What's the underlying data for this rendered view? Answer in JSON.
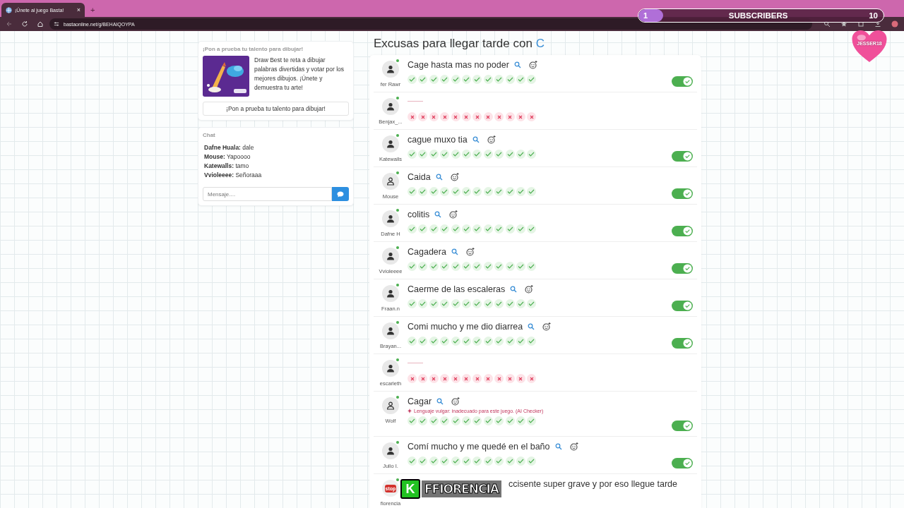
{
  "browser": {
    "tab_title": "¡Únete al juego Basta!",
    "tab_close": "×",
    "new_tab": "+",
    "url": "bastaonline.net/g/BEHAIQOYPA"
  },
  "promo": {
    "heading": "¡Pon a prueba tu talento para dibujar!",
    "text": "Draw Best te reta a dibujar palabras divertidas y votar por los mejores dibujos. ¡Únete y demuestra tu arte!",
    "button": "¡Pon a prueba tu talento para dibujar!"
  },
  "chat": {
    "heading": "Chat",
    "messages": [
      {
        "user": "Dafne Huala:",
        "text": "dale"
      },
      {
        "user": "Mouse:",
        "text": "Yapoooo"
      },
      {
        "user": "Katewalls:",
        "text": "tamo"
      },
      {
        "user": "Vvioleeee:",
        "text": "Señoraaa"
      }
    ],
    "placeholder": "Mensaje...."
  },
  "category": {
    "title": "Excusas para llegar tarde con",
    "letter": "C"
  },
  "rows": [
    {
      "user": "fer Rawr",
      "avatar": {
        "kind": "person"
      },
      "kind": "word",
      "answer": "Cage hasta mas no poder",
      "votes": [
        true,
        true,
        true,
        true,
        true,
        true,
        true,
        true,
        true,
        true,
        true,
        true
      ],
      "on": true
    },
    {
      "user": "Benjax_...",
      "avatar": {
        "kind": "person"
      },
      "kind": "empty",
      "votes": [
        false,
        false,
        false,
        false,
        false,
        false,
        false,
        false,
        false,
        false,
        false,
        false
      ]
    },
    {
      "user": "Katewalls",
      "avatar": {
        "kind": "person"
      },
      "kind": "word",
      "answer": "cague muxo tia",
      "votes": [
        true,
        true,
        true,
        true,
        true,
        true,
        true,
        true,
        true,
        true,
        true,
        true
      ],
      "on": true
    },
    {
      "user": "Mouse",
      "avatar": {
        "kind": "outline"
      },
      "kind": "word",
      "answer": "Caida",
      "votes": [
        true,
        true,
        true,
        true,
        true,
        true,
        true,
        true,
        true,
        true,
        true,
        true
      ],
      "on": true
    },
    {
      "user": "Dafne H",
      "avatar": {
        "kind": "person"
      },
      "kind": "word",
      "answer": "colitis",
      "votes": [
        true,
        true,
        true,
        true,
        true,
        true,
        true,
        true,
        true,
        true,
        true,
        true
      ],
      "on": true
    },
    {
      "user": "Vvioleeee",
      "avatar": {
        "kind": "person"
      },
      "kind": "word",
      "answer": "Cagadera",
      "votes": [
        true,
        true,
        true,
        true,
        true,
        true,
        true,
        true,
        true,
        true,
        true,
        true
      ],
      "on": true
    },
    {
      "user": "Fraan.n",
      "avatar": {
        "kind": "person"
      },
      "kind": "word",
      "answer": "Caerme de las escaleras",
      "votes": [
        true,
        true,
        true,
        true,
        true,
        true,
        true,
        true,
        true,
        true,
        true,
        true
      ],
      "on": true
    },
    {
      "user": "Brayan...",
      "avatar": {
        "kind": "person"
      },
      "kind": "word",
      "answer": "Comi mucho y me dio diarrea",
      "votes": [
        true,
        true,
        true,
        true,
        true,
        true,
        true,
        true,
        true,
        true,
        true,
        true
      ],
      "on": true
    },
    {
      "user": "escarleth",
      "avatar": {
        "kind": "person"
      },
      "kind": "empty",
      "votes": [
        false,
        false,
        false,
        false,
        false,
        false,
        false,
        false,
        false,
        false,
        false,
        false
      ]
    },
    {
      "user": "Wolf",
      "avatar": {
        "kind": "outline"
      },
      "kind": "word",
      "answer": "Cagar",
      "warning": "Lenguaje vulgar: inadecuado para este juego.",
      "warning_source": "(AI Checker)",
      "votes": [
        true,
        true,
        true,
        true,
        true,
        true,
        true,
        true,
        true,
        true,
        true,
        true
      ],
      "on": true
    },
    {
      "user": "Julio I.",
      "avatar": {
        "kind": "person"
      },
      "kind": "word",
      "answer": "Comí mucho y me quedé en el baño",
      "votes": [
        true,
        true,
        true,
        true,
        true,
        true,
        true,
        true,
        true,
        true,
        true,
        true
      ],
      "on": true
    },
    {
      "user": "fiorencia",
      "avatar": {
        "kind": "stop",
        "text": "stop"
      },
      "kind": "word",
      "answer": "ccisente super grave y por eso llegue tarde"
    }
  ],
  "overlay": {
    "subscribers": {
      "count": "1",
      "label": "SUBSCRIBERS",
      "goal": "10",
      "level": 0.1
    },
    "heart_name": "JESSER18",
    "caption_badge": "K",
    "caption": "FFIORENCIA"
  }
}
